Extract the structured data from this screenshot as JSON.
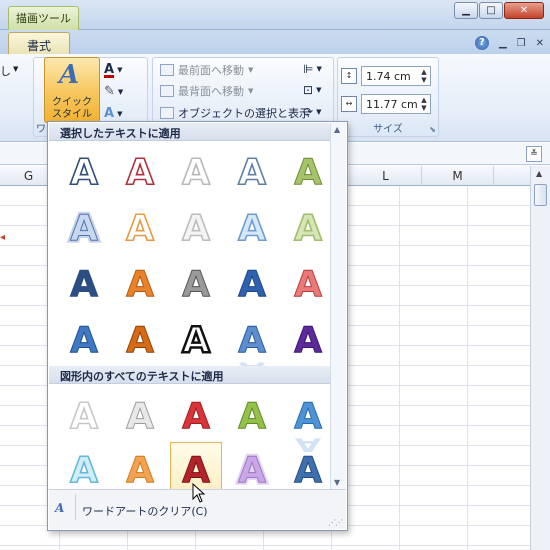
{
  "titlebar": {
    "contextual_tab": "描画ツール"
  },
  "tabs": {
    "format": "書式"
  },
  "ribbon": {
    "left_fragment": "し",
    "quick_style_label": "クイック\nスタイル",
    "wordart_group_fragment": "ワ",
    "arrange": {
      "bring_front": "最前面へ移動",
      "send_back": "最背面へ移動",
      "selection_pane": "オブジェクトの選択と表示"
    },
    "size": {
      "height": "1.74 cm",
      "width": "11.77 cm",
      "group_label": "サイズ"
    }
  },
  "sheet": {
    "columns": [
      "G",
      "L",
      "M"
    ]
  },
  "gallery": {
    "section1_title": "選択したテキストに適用",
    "section2_title": "図形内のすべてのテキストに適用",
    "clear_label": "ワードアートのクリア(C)",
    "tile_glyph": "A",
    "section1": [
      [
        {
          "fill": "#ffffff",
          "stroke": "#2f4f7a",
          "style": "outline"
        },
        {
          "fill": "#ffffff",
          "stroke": "#b0303a",
          "style": "outline"
        },
        {
          "fill": "#ffffff",
          "stroke": "#b8b8b8",
          "style": "outline"
        },
        {
          "fill": "#ffffff",
          "stroke": "#5f7fa8",
          "style": "outline"
        },
        {
          "fill": "#a5c46a",
          "stroke": "#6d8c35",
          "style": "solid"
        }
      ],
      [
        {
          "fill": "#c9d8ee",
          "stroke": "#4f74b3",
          "style": "glow"
        },
        {
          "fill": "#ffffff",
          "stroke": "#e79a45",
          "style": "outline"
        },
        {
          "fill": "#f4f4f4",
          "stroke": "#bdbdbd",
          "style": "outline"
        },
        {
          "fill": "#d7e7f6",
          "stroke": "#6c9cd0",
          "style": "outline"
        },
        {
          "fill": "#d6e6b6",
          "stroke": "#9fbd6a",
          "style": "outline"
        }
      ],
      [
        {
          "fill": "#2c4e82",
          "stroke": "#2c4e82",
          "style": "bevel"
        },
        {
          "fill": "#e9822b",
          "stroke": "#b25d12",
          "style": "bevel"
        },
        {
          "fill": "#9a9a9a",
          "stroke": "#555555",
          "style": "metal"
        },
        {
          "fill": "#2e62b0",
          "stroke": "#1f4683",
          "style": "solid"
        },
        {
          "fill": "#e97a78",
          "stroke": "#b93c3c",
          "style": "bevel"
        }
      ],
      [
        {
          "fill": "#3f78c3",
          "stroke": "#244f8c",
          "style": "solid"
        },
        {
          "fill": "#d76a15",
          "stroke": "#8f420a",
          "style": "solid"
        },
        {
          "fill": "#ffffff",
          "stroke": "#111111",
          "style": "black"
        },
        {
          "fill": "#5d8fd0",
          "stroke": "#2d5a98",
          "style": "reflect"
        },
        {
          "fill": "#5d2a9a",
          "stroke": "#3b1570",
          "style": "solid"
        }
      ]
    ],
    "section2": [
      [
        {
          "fill": "#ffffff",
          "stroke": "#c7c7c7",
          "style": "outline"
        },
        {
          "fill": "#e8e8e8",
          "stroke": "#9c9c9c",
          "style": "metal"
        },
        {
          "fill": "#d8343a",
          "stroke": "#9e1d22",
          "style": "solid"
        },
        {
          "fill": "#94c14a",
          "stroke": "#5f8a22",
          "style": "solid"
        },
        {
          "fill": "#4d94d7",
          "stroke": "#2a6bab",
          "style": "reflect"
        }
      ],
      [
        {
          "fill": "#cfeef8",
          "stroke": "#66b9d6",
          "style": "outline"
        },
        {
          "fill": "#f2a253",
          "stroke": "#d27a1e",
          "style": "solid"
        },
        {
          "fill": "#b3232a",
          "stroke": "#7a1116",
          "style": "solid"
        },
        {
          "fill": "#c9a7e6",
          "stroke": "#9d76c7",
          "style": "glow"
        },
        {
          "fill": "#3e6fae",
          "stroke": "#244c82",
          "style": "reflect"
        }
      ]
    ]
  }
}
